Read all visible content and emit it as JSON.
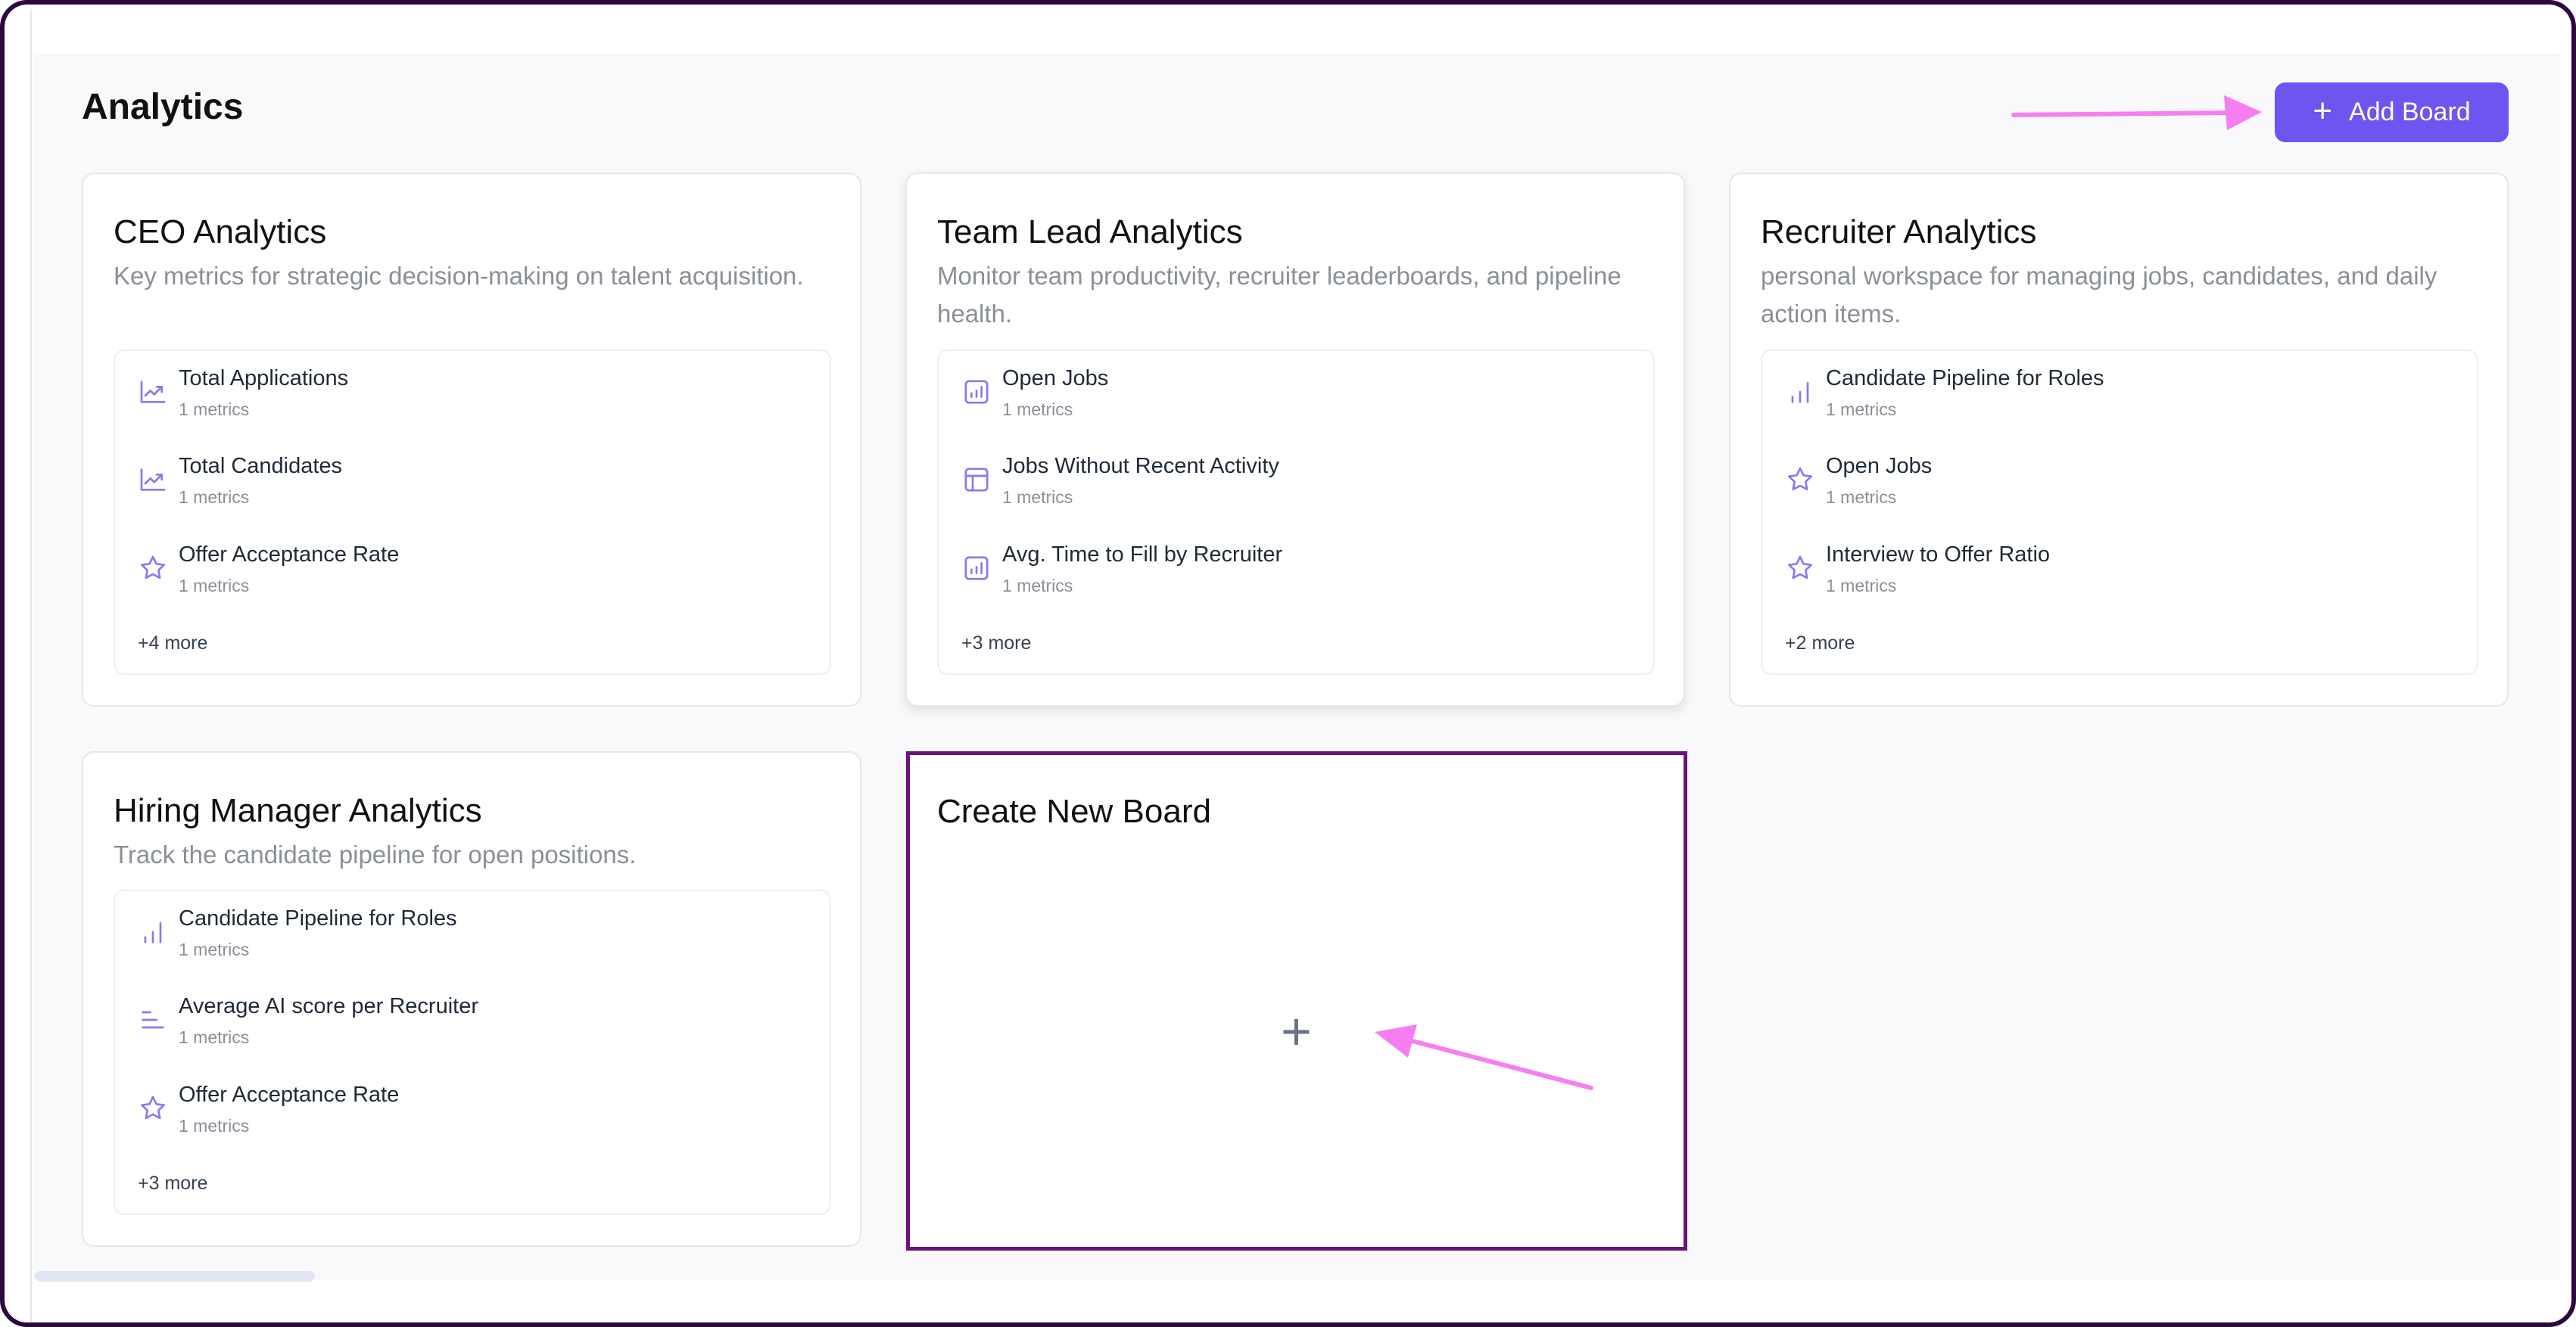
{
  "page": {
    "title": "Analytics"
  },
  "header": {
    "add_board_icon": "plus-icon",
    "add_board_label": "Add Board"
  },
  "boards": [
    {
      "title": "CEO Analytics",
      "description": "Key metrics for strategic decision-making on talent acquisition.",
      "metrics": [
        {
          "name": "Total Applications",
          "sub": "1 metrics",
          "icon": "trend-line-icon"
        },
        {
          "name": "Total Candidates",
          "sub": "1 metrics",
          "icon": "trend-line-icon"
        },
        {
          "name": "Offer Acceptance Rate",
          "sub": "1 metrics",
          "icon": "star-icon"
        }
      ],
      "more": "+4 more"
    },
    {
      "title": "Team Lead Analytics",
      "description": "Monitor team productivity, recruiter leaderboards, and pipeline health.",
      "metrics": [
        {
          "name": "Open Jobs",
          "sub": "1 metrics",
          "icon": "bar-chart-box-icon"
        },
        {
          "name": "Jobs Without Recent Activity",
          "sub": "1 metrics",
          "icon": "table-icon"
        },
        {
          "name": "Avg. Time to Fill by Recruiter",
          "sub": "1 metrics",
          "icon": "bar-chart-box-icon"
        }
      ],
      "more": "+3 more"
    },
    {
      "title": "Recruiter Analytics",
      "description": "personal workspace for managing jobs, candidates, and daily action items.",
      "metrics": [
        {
          "name": "Candidate Pipeline for Roles",
          "sub": "1 metrics",
          "icon": "bar-chart-icon"
        },
        {
          "name": "Open Jobs",
          "sub": "1 metrics",
          "icon": "star-icon"
        },
        {
          "name": "Interview to Offer Ratio",
          "sub": "1 metrics",
          "icon": "star-icon"
        }
      ],
      "more": "+2 more"
    },
    {
      "title": "Hiring Manager Analytics",
      "description": "Track the candidate pipeline for open positions.",
      "metrics": [
        {
          "name": "Candidate Pipeline for Roles",
          "sub": "1 metrics",
          "icon": "bar-chart-icon"
        },
        {
          "name": "Average AI score per Recruiter",
          "sub": "1 metrics",
          "icon": "horizontal-bars-icon"
        },
        {
          "name": "Offer Acceptance Rate",
          "sub": "1 metrics",
          "icon": "star-icon"
        }
      ],
      "more": "+3 more"
    }
  ],
  "create_board": {
    "title": "Create New Board",
    "icon": "plus-icon"
  },
  "annotations": {
    "arrow_color": "#f77ef0"
  },
  "colors": {
    "accent": "#6e55f0",
    "highlight_border": "#6b137c",
    "icon": "#8a78ee"
  }
}
